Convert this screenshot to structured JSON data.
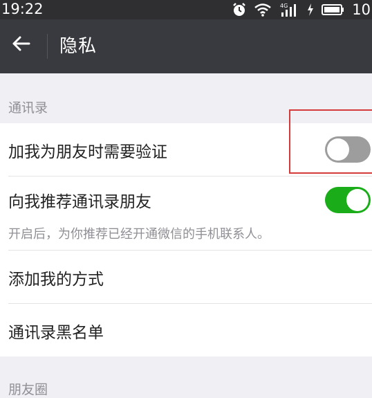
{
  "status_bar": {
    "time": "19:22",
    "network_label": "4G",
    "battery_level_text": "10",
    "icons": [
      "alarm-icon",
      "wifi-icon",
      "signal-icon",
      "charging-icon",
      "battery-icon"
    ]
  },
  "app_bar": {
    "back_icon": "back-arrow-icon",
    "title": "隐私"
  },
  "sections": {
    "contacts_header": "通讯录",
    "moments_header": "朋友圈"
  },
  "rows": {
    "verify_friend": {
      "label": "加我为朋友时需要验证",
      "toggle_on": false
    },
    "recommend_contacts": {
      "label": "向我推荐通讯录朋友",
      "toggle_on": true,
      "description": "开启后，为你推荐已经开通微信的手机联系人。"
    },
    "add_methods": {
      "label": "添加我的方式"
    },
    "blacklist": {
      "label": "通讯录黑名单"
    }
  },
  "colors": {
    "toggle_on": "#1aad19",
    "toggle_off": "#9d9d9d",
    "annotation_box": "#d43a3a",
    "app_bar": "#393a3f"
  }
}
